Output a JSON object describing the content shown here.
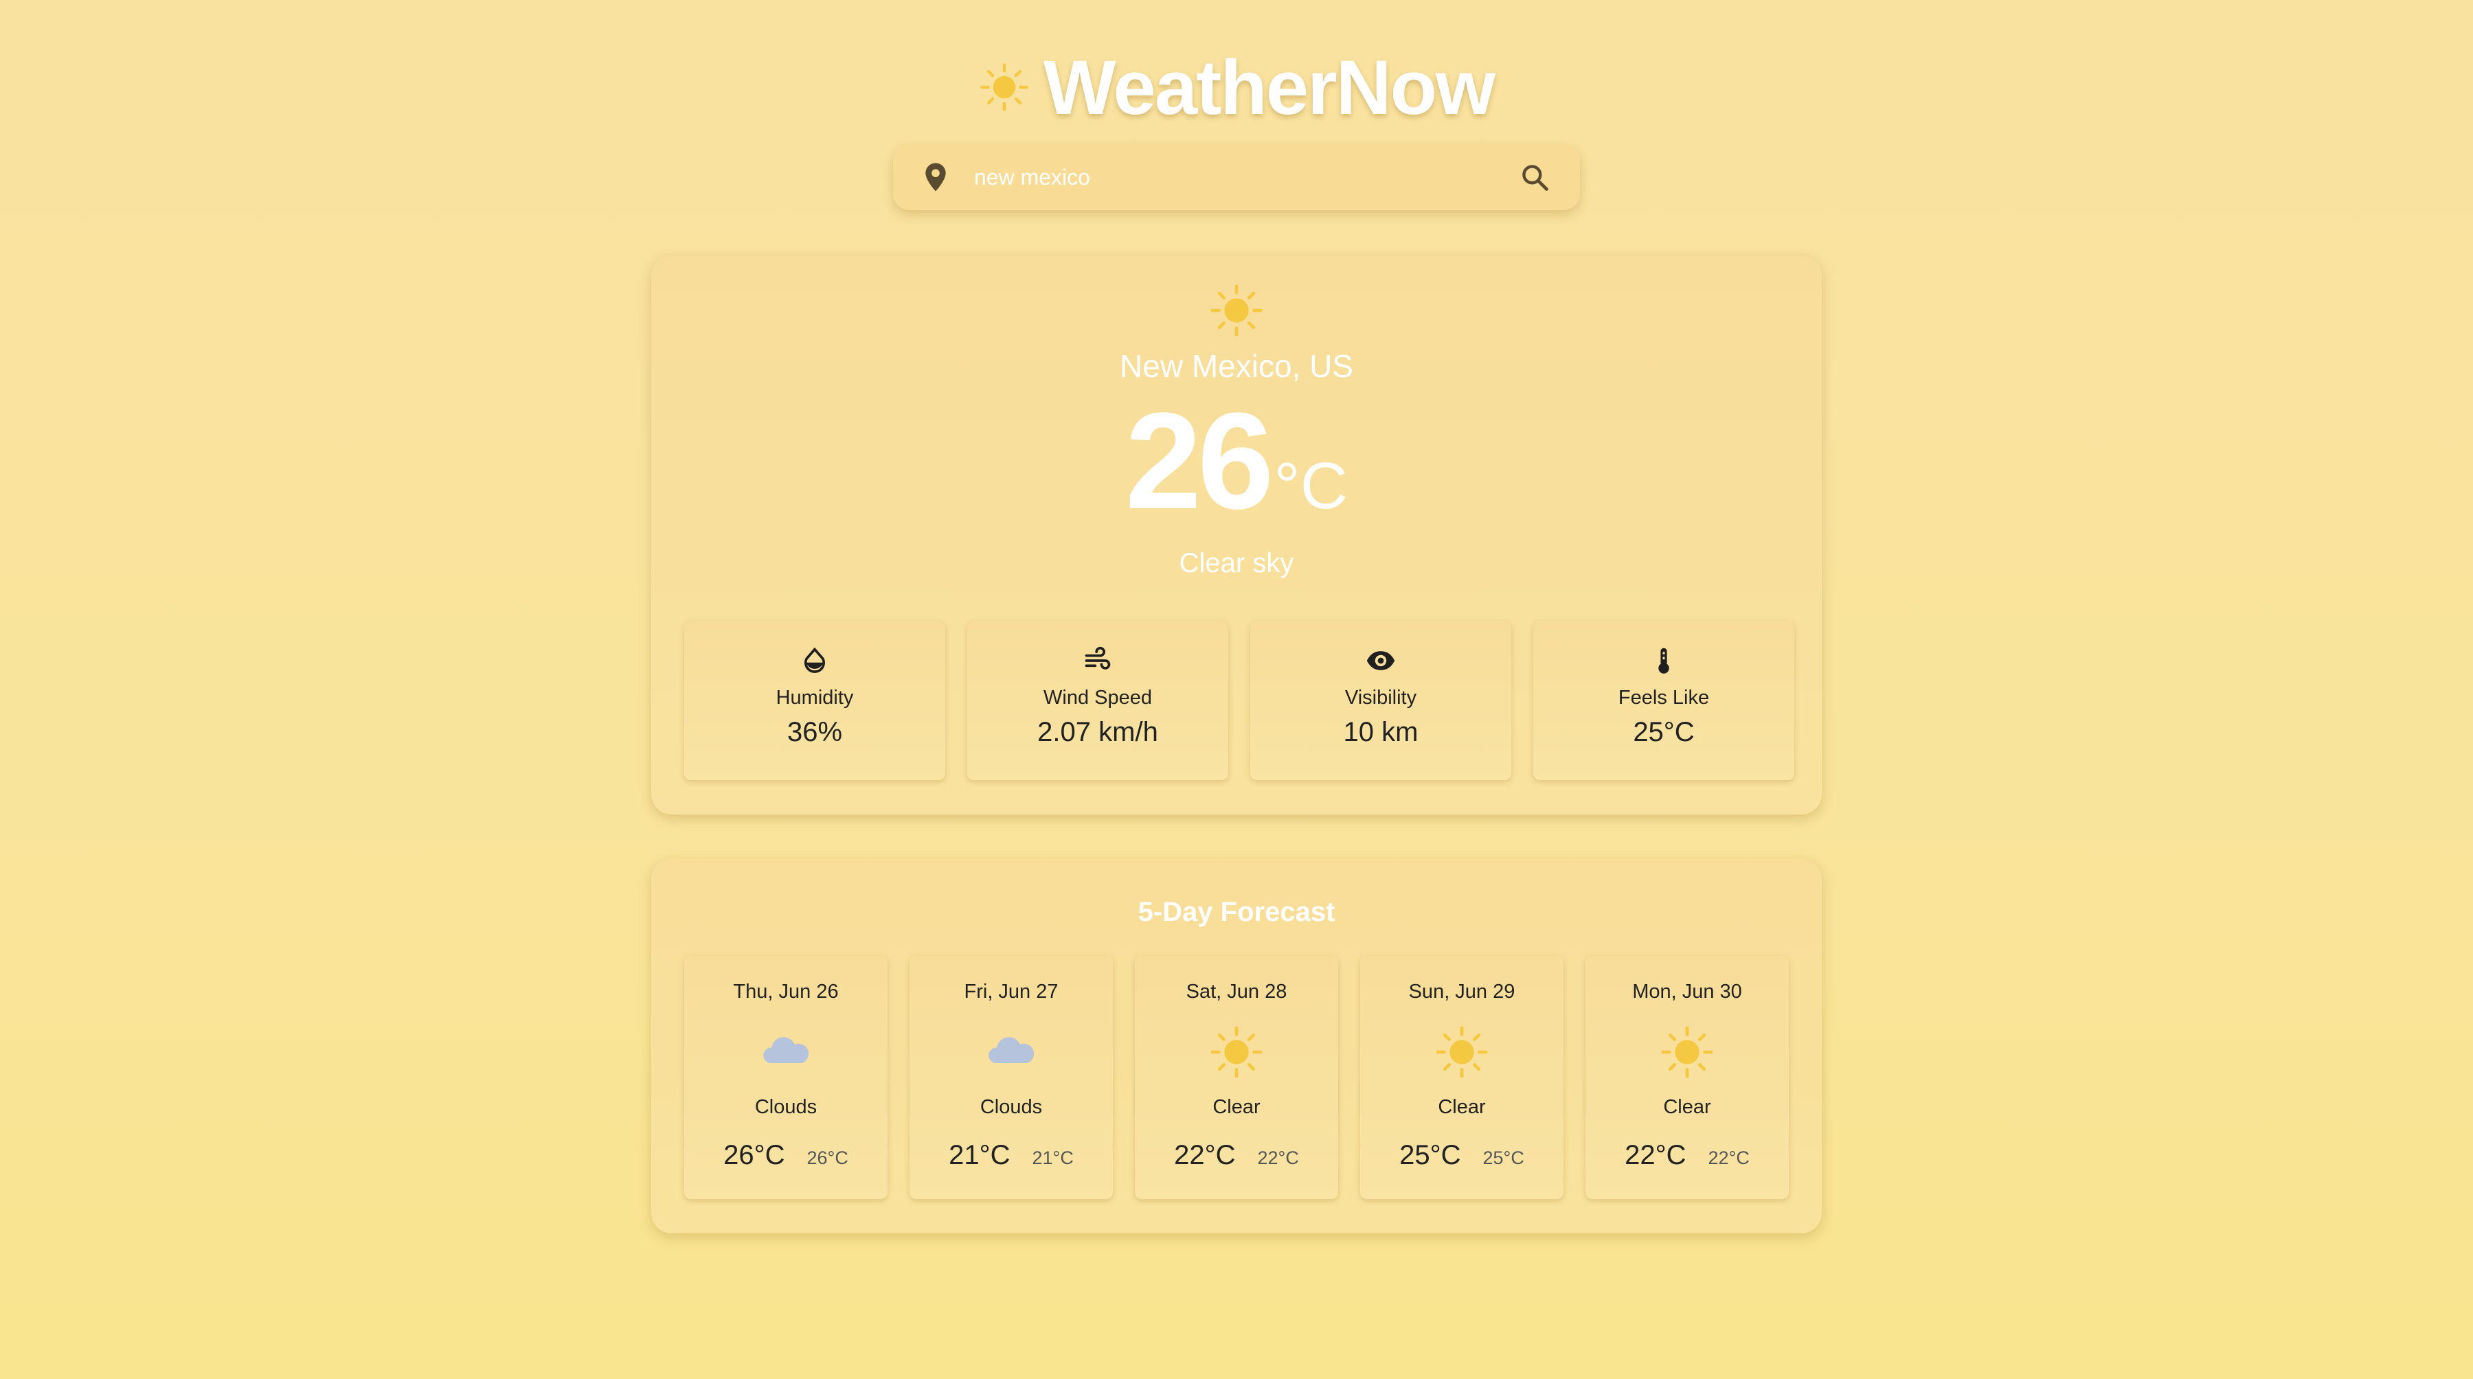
{
  "app": {
    "title": "WeatherNow",
    "logo_icon": "sun-icon"
  },
  "search": {
    "value": "new mexico",
    "placeholder": "Search city",
    "location_icon": "map-pin-icon",
    "search_icon": "search-icon"
  },
  "current": {
    "icon": "sun-icon",
    "location": "New Mexico, US",
    "temperature": "26",
    "unit": "°C",
    "description": "Clear sky",
    "stats": [
      {
        "icon": "water-drop-icon",
        "label": "Humidity",
        "value": "36%"
      },
      {
        "icon": "wind-icon",
        "label": "Wind Speed",
        "value": "2.07 km/h"
      },
      {
        "icon": "eye-icon",
        "label": "Visibility",
        "value": "10 km"
      },
      {
        "icon": "thermometer-icon",
        "label": "Feels Like",
        "value": "25°C"
      }
    ]
  },
  "forecast": {
    "title": "5-Day Forecast",
    "days": [
      {
        "date": "Thu, Jun 26",
        "icon": "cloud-icon",
        "description": "Clouds",
        "high": "26°C",
        "low": "26°C"
      },
      {
        "date": "Fri, Jun 27",
        "icon": "cloud-icon",
        "description": "Clouds",
        "high": "21°C",
        "low": "21°C"
      },
      {
        "date": "Sat, Jun 28",
        "icon": "sun-icon",
        "description": "Clear",
        "high": "22°C",
        "low": "22°C"
      },
      {
        "date": "Sun, Jun 29",
        "icon": "sun-icon",
        "description": "Clear",
        "high": "25°C",
        "low": "25°C"
      },
      {
        "date": "Mon, Jun 30",
        "icon": "sun-icon",
        "description": "Clear",
        "high": "22°C",
        "low": "22°C"
      }
    ]
  },
  "colors": {
    "background": "#f9e2a0",
    "sun": "#f5c842",
    "cloud": "#b6c3dc",
    "text_light": "#ffffff",
    "text_dark": "#222222"
  }
}
